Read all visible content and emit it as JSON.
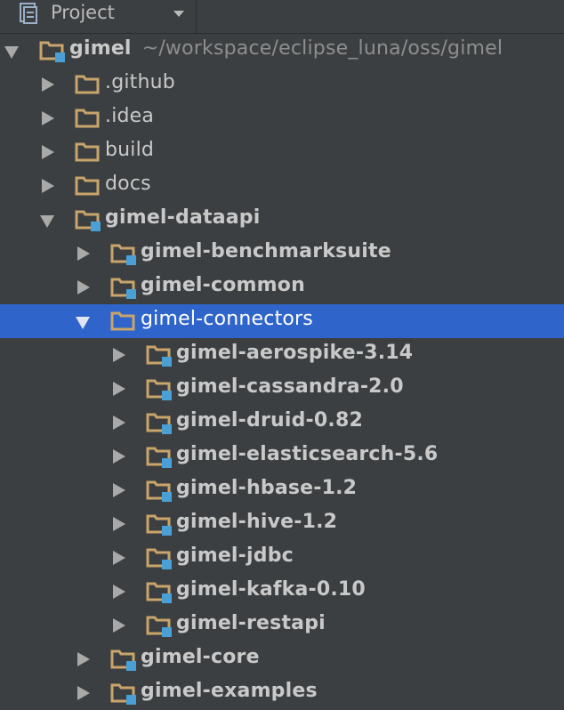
{
  "header": {
    "title": "Project",
    "icon": "project-icon"
  },
  "colors": {
    "folder": "#c9a46b",
    "module_marker": "#4a9fd5",
    "selection": "#2f65ca",
    "background": "#3c3f41"
  },
  "tree": [
    {
      "label": "gimel",
      "path": "~/workspace/eclipse_luna/oss/gimel",
      "level": 0,
      "expanded": true,
      "module": true,
      "bold": true
    },
    {
      "label": ".github",
      "level": 1,
      "expanded": false,
      "module": false
    },
    {
      "label": ".idea",
      "level": 1,
      "expanded": false,
      "module": false
    },
    {
      "label": "build",
      "level": 1,
      "expanded": false,
      "module": false
    },
    {
      "label": "docs",
      "level": 1,
      "expanded": false,
      "module": false
    },
    {
      "label": "gimel-dataapi",
      "level": 1,
      "expanded": true,
      "module": true,
      "bold": true
    },
    {
      "label": "gimel-benchmarksuite",
      "level": 2,
      "expanded": false,
      "module": true,
      "bold": true
    },
    {
      "label": "gimel-common",
      "level": 2,
      "expanded": false,
      "module": true,
      "bold": true
    },
    {
      "label": "gimel-connectors",
      "level": 2,
      "expanded": true,
      "module": false,
      "selected": true
    },
    {
      "label": "gimel-aerospike-3.14",
      "level": 3,
      "expanded": false,
      "module": true,
      "bold": true
    },
    {
      "label": "gimel-cassandra-2.0",
      "level": 3,
      "expanded": false,
      "module": true,
      "bold": true
    },
    {
      "label": "gimel-druid-0.82",
      "level": 3,
      "expanded": false,
      "module": true,
      "bold": true
    },
    {
      "label": "gimel-elasticsearch-5.6",
      "level": 3,
      "expanded": false,
      "module": true,
      "bold": true
    },
    {
      "label": "gimel-hbase-1.2",
      "level": 3,
      "expanded": false,
      "module": true,
      "bold": true
    },
    {
      "label": "gimel-hive-1.2",
      "level": 3,
      "expanded": false,
      "module": true,
      "bold": true
    },
    {
      "label": "gimel-jdbc",
      "level": 3,
      "expanded": false,
      "module": true,
      "bold": true
    },
    {
      "label": "gimel-kafka-0.10",
      "level": 3,
      "expanded": false,
      "module": true,
      "bold": true
    },
    {
      "label": "gimel-restapi",
      "level": 3,
      "expanded": false,
      "module": true,
      "bold": true
    },
    {
      "label": "gimel-core",
      "level": 2,
      "expanded": false,
      "module": true,
      "bold": true
    },
    {
      "label": "gimel-examples",
      "level": 2,
      "expanded": false,
      "module": true,
      "bold": true
    }
  ]
}
